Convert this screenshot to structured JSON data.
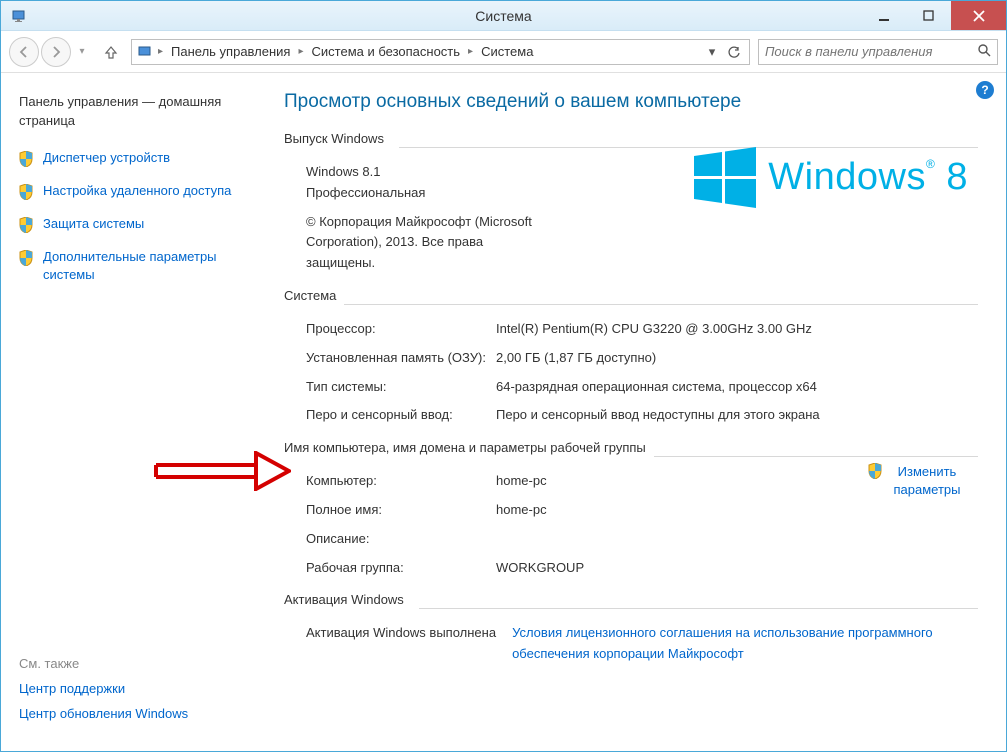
{
  "titlebar": {
    "title": "Система"
  },
  "nav": {
    "crumbs": [
      "Панель управления",
      "Система и безопасность",
      "Система"
    ],
    "search_placeholder": "Поиск в панели управления"
  },
  "sidebar": {
    "home": "Панель управления — домашняя страница",
    "links": [
      "Диспетчер устройств",
      "Настройка удаленного доступа",
      "Защита системы",
      "Дополнительные параметры системы"
    ],
    "see_also_header": "См. также",
    "see_also": [
      "Центр поддержки",
      "Центр обновления Windows"
    ]
  },
  "main": {
    "title": "Просмотр основных сведений о вашем компьютере",
    "edition": {
      "header": "Выпуск Windows",
      "name": "Windows 8.1",
      "variant": "Профессиональная",
      "copyright": "© Корпорация Майкрософт (Microsoft Corporation), 2013. Все права защищены.",
      "logo_text": "Windows",
      "logo_version": "8"
    },
    "system": {
      "header": "Система",
      "rows": {
        "processor_label": "Процессор:",
        "processor_value": "Intel(R) Pentium(R) CPU G3220 @ 3.00GHz   3.00 GHz",
        "ram_label": "Установленная память (ОЗУ):",
        "ram_value": "2,00 ГБ (1,87 ГБ доступно)",
        "type_label": "Тип системы:",
        "type_value": "64-разрядная операционная система, процессор x64",
        "pen_label": "Перо и сенсорный ввод:",
        "pen_value": "Перо и сенсорный ввод недоступны для этого экрана"
      }
    },
    "workgroup": {
      "header": "Имя компьютера, имя домена и параметры рабочей группы",
      "rows": {
        "computer_label": "Компьютер:",
        "computer_value": "home-pc",
        "fullname_label": "Полное имя:",
        "fullname_value": "home-pc",
        "description_label": "Описание:",
        "description_value": "",
        "workgroup_label": "Рабочая группа:",
        "workgroup_value": "WORKGROUP"
      },
      "change_settings": "Изменить параметры"
    },
    "activation": {
      "header": "Активация Windows",
      "status": "Активация Windows выполнена",
      "terms_link": "Условия лицензионного соглашения на использование программного обеспечения корпорации Майкрософт"
    }
  }
}
